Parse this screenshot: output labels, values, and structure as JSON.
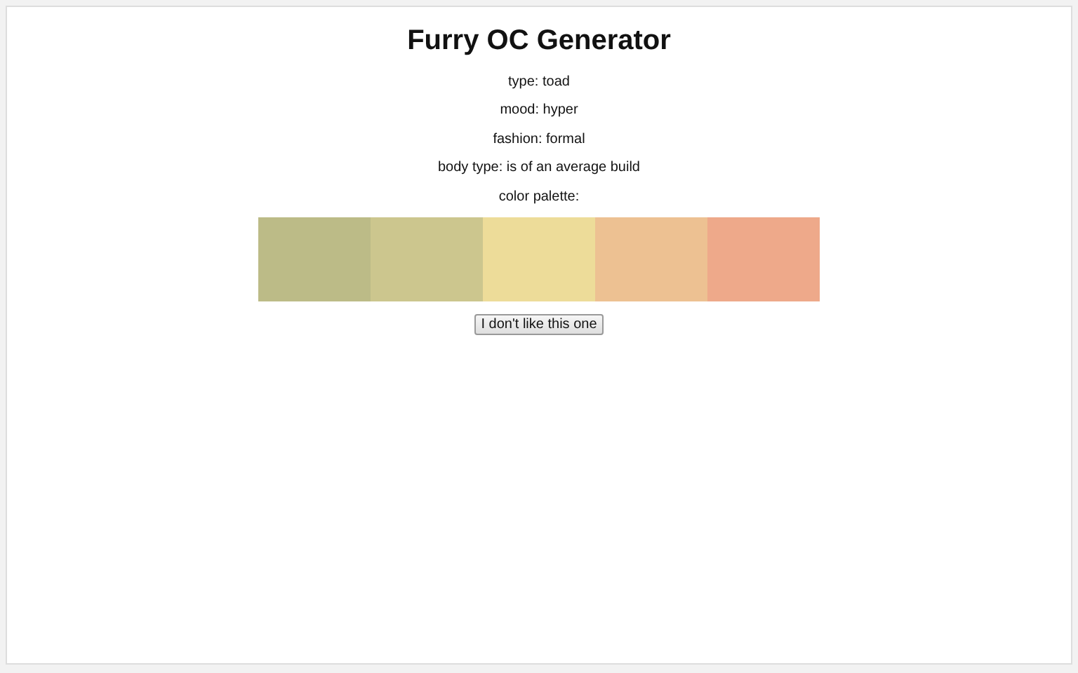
{
  "title": "Furry OC Generator",
  "traits": [
    "type: toad",
    "mood: hyper",
    "fashion: formal",
    "body type: is of an average build"
  ],
  "palette_label": "color palette:",
  "palette": [
    {
      "color": "#bcbb87"
    },
    {
      "color": "#ccc68e"
    },
    {
      "color": "#eddc99"
    },
    {
      "color": "#edc192"
    },
    {
      "color": "#eea98a"
    }
  ],
  "button": "I don't like this one"
}
